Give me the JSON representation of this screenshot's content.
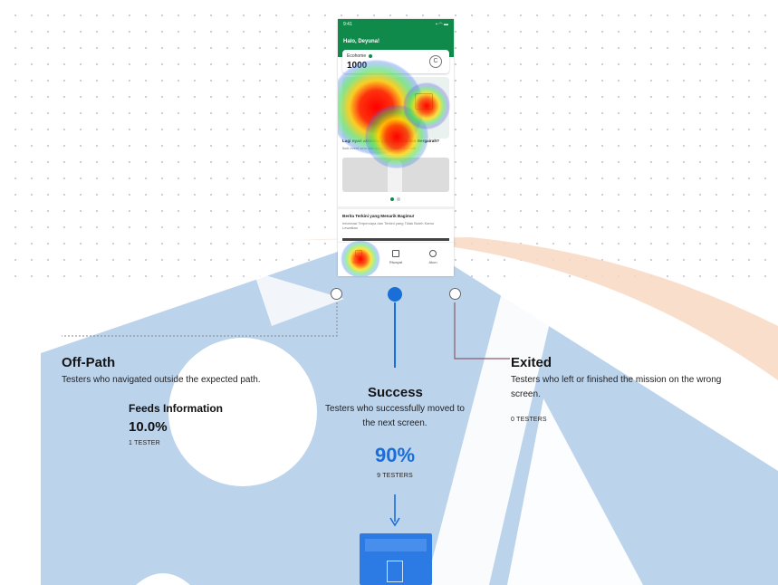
{
  "phone": {
    "status_time": "9:41",
    "status_icons": "▪ ◠ ▬",
    "greeting": "Halo, Deyuna!",
    "card_label": "Ecohome",
    "card_value": "1000",
    "coin_glyph": "C",
    "section_title": "Lagi nyari aktivitas yang Menarik dan Bergairah?",
    "section_sub": "Ikuti event seru dan dapatkan reward menarik",
    "news_title": "Berita Terkini yang Menarik Bagimu!",
    "news_body": "Informasi Terpercaya dan Terkini yang Tidak Boleh Kamu Lewatkan",
    "nav": [
      "Beranda",
      "Riwayat",
      "Akun"
    ]
  },
  "paths": {
    "off_path": {
      "title": "Off-Path",
      "description": "Testers who navigated outside the expected path.",
      "target_name": "Feeds Information",
      "percent": "10.0%",
      "testers": "1 TESTER"
    },
    "success": {
      "title": "Success",
      "description": "Testers who successfully moved to the next screen.",
      "percent": "90%",
      "testers": "9 TESTERS"
    },
    "exited": {
      "title": "Exited",
      "description": "Testers who left or finished the mission on the wrong screen.",
      "testers": "0 TESTERS"
    }
  },
  "colors": {
    "brand_green": "#0f8a4a",
    "success_blue": "#1a6ed8",
    "exited_line": "#8a5a6a",
    "watermark_blue": "#bcd3ec",
    "watermark_orange": "#f6cfb4"
  }
}
